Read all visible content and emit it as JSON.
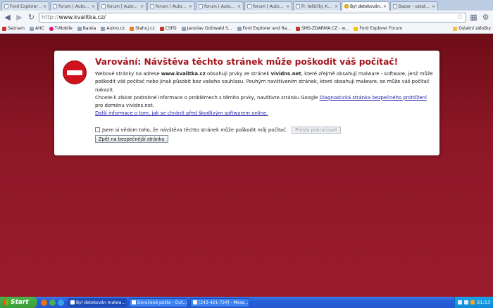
{
  "tabs": [
    {
      "title": "Ford Explorer ...",
      "active": false
    },
    {
      "title": "forum | Auto...",
      "active": false
    },
    {
      "title": "forum | Auto...",
      "active": false
    },
    {
      "title": "forum | Auto...",
      "active": false
    },
    {
      "title": "forum | Auto...",
      "active": false
    },
    {
      "title": "forum | Auto...",
      "active": false
    },
    {
      "title": "Fr. leštičky K...",
      "active": false
    },
    {
      "title": "Byl detekován...",
      "active": true
    },
    {
      "title": "Bazar - ostat...",
      "active": false
    }
  ],
  "address": {
    "scheme": "http://",
    "host": "www.kvalitka.cz/"
  },
  "bookmarks": [
    {
      "label": "Seznam",
      "color": "red"
    },
    {
      "label": "AHC",
      "color": "gray"
    },
    {
      "label": "T-Mobile",
      "color": "pink"
    },
    {
      "label": "Banka",
      "color": "gray"
    },
    {
      "label": "Aukro.cz",
      "color": "gray"
    },
    {
      "label": "Stahuj.cz",
      "color": "orange"
    },
    {
      "label": "CSFD",
      "color": "red"
    },
    {
      "label": "Jaroslav Gottwald S...",
      "color": "gray"
    },
    {
      "label": "Ford Explorer and Ra...",
      "color": "gray"
    },
    {
      "label": "SMS-ZDARMA.CZ - w...",
      "color": "red"
    },
    {
      "label": "Ford Explorer Forum",
      "color": "yellow"
    }
  ],
  "other_bookmarks": "Ostatní záložky",
  "warning": {
    "title": "Varování: Návštěva těchto stránek může poškodit váš počítač!",
    "p1_pre": "Webové stránky na adrese ",
    "site": "www.kvalitka.cz",
    "p1_mid": " obsahují prvky ze stránek ",
    "malware_site": "vividns.net",
    "p1_post": ", které zřejmě obsahují malware - software, jenž může poškodit váš počítač nebo jinak působit bez vašeho souhlasu. Pouhým navštívením stránek, které obsahují malware, se může váš počítač nakazit.",
    "p2_pre": "Chcete-li získat podrobné informace o problémech s těmito prvky, navštivte stránku Google ",
    "p2_link": "Diagnostická stránka bezpečného prohlížení",
    "p2_post": " pro doménu vividns.net.",
    "more_link": "Další informace o tom, jak se chránit před škodlivým softwarem online.",
    "checkbox_label": "Jsem si vědom toho, že návštěva těchto stránek může poškodit můj počítač.",
    "proceed_button": "Přesto pokračovat",
    "back_button": "Zpět na bezpečnější stránku"
  },
  "taskbar": {
    "start": "Start",
    "tasks": [
      {
        "label": "Byl detekován malwa...",
        "active": true
      },
      {
        "label": "Doručená pošta - Out...",
        "active": false
      },
      {
        "label": "[243-421-724] - Mess...",
        "active": false
      }
    ],
    "clock": "21:13"
  }
}
